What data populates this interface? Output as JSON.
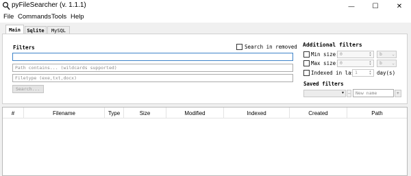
{
  "window": {
    "title": "pyFileSearcher (v. 1.1.1)",
    "icon": "magnifier-icon",
    "minimize_glyph": "—",
    "maximize_glyph": "☐",
    "close_glyph": "✕"
  },
  "menu": [
    "File",
    "Commands",
    "Tools",
    "Help"
  ],
  "tabs": [
    "Main",
    "Sqlite",
    "MySQL"
  ],
  "filters": {
    "heading": "Filters",
    "search_in_removed": "Search in removed",
    "main_value": "",
    "path_placeholder": "Path contains... (wildcards supported)",
    "filetype_placeholder": "Filetype (exe,txt,docx)",
    "search_button": "Search..."
  },
  "additional": {
    "heading": "Additional filters",
    "min_size_label": "Min size:",
    "min_size_value": "0",
    "max_size_label": "Max size:",
    "max_size_value": "0",
    "size_unit": "b",
    "indexed_label": "Indexed in last",
    "indexed_value": "1",
    "indexed_unit": "day(s)",
    "saved_heading": "Saved filters",
    "minus_label": "–",
    "new_name_placeholder": "New name",
    "plus_label": "+"
  },
  "table": {
    "columns": [
      "#",
      "Filename",
      "Type",
      "Size",
      "Modified",
      "Indexed",
      "Created",
      "Path"
    ]
  },
  "colors": {
    "focus_border": "#3c82c8",
    "window_bg": "#f0f0f0"
  }
}
